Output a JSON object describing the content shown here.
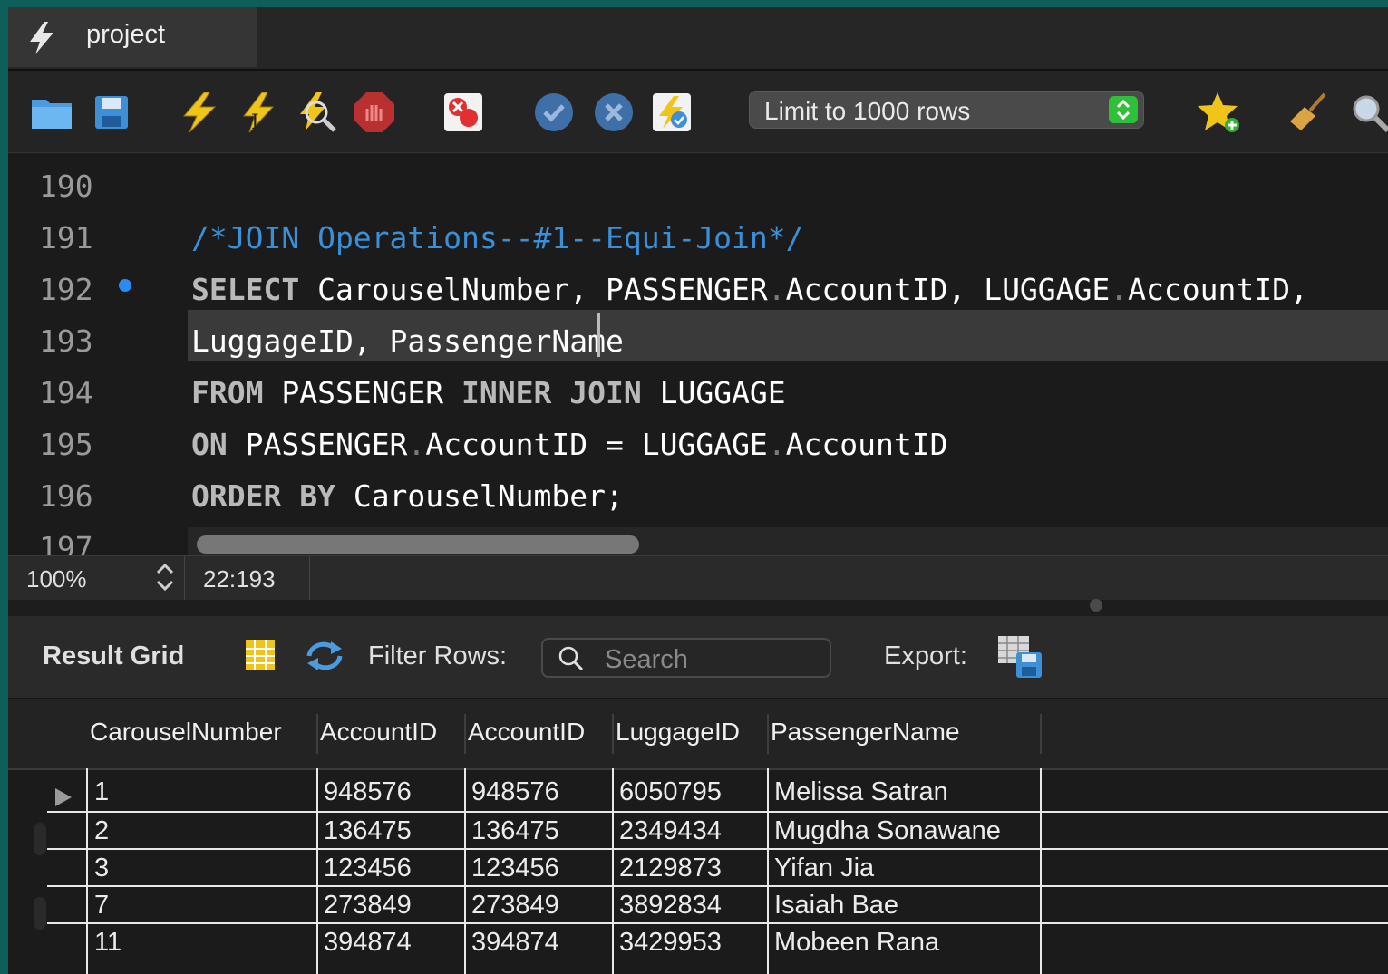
{
  "tab": {
    "title": "project"
  },
  "toolbar": {
    "limit_label": "Limit to 1000 rows",
    "icons": [
      "folder-icon",
      "save-icon",
      "execute-icon",
      "execute-current-icon",
      "explain-icon",
      "stop-icon",
      "toggle-error-icon",
      "commit-icon",
      "rollback-icon",
      "autocommit-icon",
      "bookmark-star-icon",
      "beautify-broom-icon",
      "find-icon"
    ]
  },
  "editor": {
    "lines": [
      {
        "num": "190",
        "segments": []
      },
      {
        "num": "191",
        "segments": [
          {
            "t": "/*JOIN Operations--#1--Equi-Join*/",
            "c": "cm"
          }
        ]
      },
      {
        "num": "192",
        "segments": [
          {
            "t": "SELECT",
            "c": "kw"
          },
          {
            "t": " CarouselNumber, PASSENGER",
            "c": ""
          },
          {
            "t": ".",
            "c": "dot"
          },
          {
            "t": "AccountID, LUGGAGE",
            "c": ""
          },
          {
            "t": ".",
            "c": "dot"
          },
          {
            "t": "AccountID,",
            "c": ""
          }
        ]
      },
      {
        "num": "193",
        "segments": [
          {
            "t": "LuggageID, PassengerName",
            "c": ""
          }
        ]
      },
      {
        "num": "194",
        "segments": [
          {
            "t": "FROM",
            "c": "kw"
          },
          {
            "t": " PASSENGER ",
            "c": ""
          },
          {
            "t": "INNER JOIN",
            "c": "kw"
          },
          {
            "t": " LUGGAGE",
            "c": ""
          }
        ]
      },
      {
        "num": "195",
        "segments": [
          {
            "t": "ON",
            "c": "kw"
          },
          {
            "t": " PASSENGER",
            "c": ""
          },
          {
            "t": ".",
            "c": "dot"
          },
          {
            "t": "AccountID = LUGGAGE",
            "c": ""
          },
          {
            "t": ".",
            "c": "dot"
          },
          {
            "t": "AccountID",
            "c": ""
          }
        ]
      },
      {
        "num": "196",
        "segments": [
          {
            "t": "ORDER BY",
            "c": "kw"
          },
          {
            "t": " CarouselNumber;",
            "c": ""
          }
        ]
      },
      {
        "num": "197",
        "segments": []
      }
    ]
  },
  "status": {
    "zoom": "100%",
    "position": "22:193"
  },
  "result_toolbar": {
    "result_grid_label": "Result Grid",
    "filter_label": "Filter Rows:",
    "search_placeholder": "Search",
    "export_label": "Export:"
  },
  "grid": {
    "columns": [
      "CarouselNumber",
      "AccountID",
      "AccountID",
      "LuggageID",
      "PassengerName"
    ],
    "rows": [
      [
        "1",
        "948576",
        "948576",
        "6050795",
        "Melissa Satran"
      ],
      [
        "2",
        "136475",
        "136475",
        "2349434",
        "Mugdha Sonawane"
      ],
      [
        "3",
        "123456",
        "123456",
        "2129873",
        "Yifan Jia"
      ],
      [
        "7",
        "273849",
        "273849",
        "3892834",
        "Isaiah Bae"
      ],
      [
        "11",
        "394874",
        "394874",
        "3429953",
        "Mobeen Rana"
      ]
    ]
  }
}
